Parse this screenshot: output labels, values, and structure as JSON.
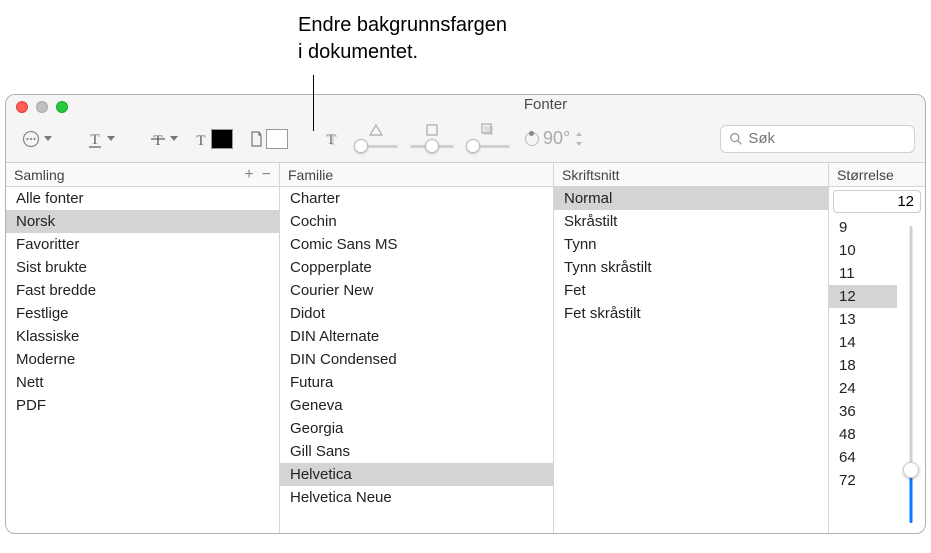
{
  "callout": {
    "line1": "Endre bakgrunnsfargen",
    "line2": "i dokumentet."
  },
  "window": {
    "title": "Fonter"
  },
  "toolbar": {
    "rotation_value": "90°"
  },
  "search": {
    "placeholder": "Søk"
  },
  "columns": {
    "samling": {
      "header": "Samling",
      "add": "+",
      "remove": "−",
      "items": [
        "Alle fonter",
        "Norsk",
        "Favoritter",
        "Sist brukte",
        "Fast bredde",
        "Festlige",
        "Klassiske",
        "Moderne",
        "Nett",
        "PDF"
      ],
      "selected_index": 1
    },
    "familie": {
      "header": "Familie",
      "items": [
        "Charter",
        "Cochin",
        "Comic Sans MS",
        "Copperplate",
        "Courier New",
        "Didot",
        "DIN Alternate",
        "DIN Condensed",
        "Futura",
        "Geneva",
        "Georgia",
        "Gill Sans",
        "Helvetica",
        "Helvetica Neue"
      ],
      "selected_index": 12
    },
    "typeface": {
      "header": "Skriftsnitt",
      "items": [
        "Normal",
        "Skråstilt",
        "Tynn",
        "Tynn skråstilt",
        "Fet",
        "Fet skråstilt"
      ],
      "selected_index": 0
    },
    "size": {
      "header": "Størrelse",
      "current": "12",
      "items": [
        "9",
        "10",
        "11",
        "12",
        "13",
        "14",
        "18",
        "24",
        "36",
        "48",
        "64",
        "72"
      ],
      "selected_index": 3
    }
  }
}
